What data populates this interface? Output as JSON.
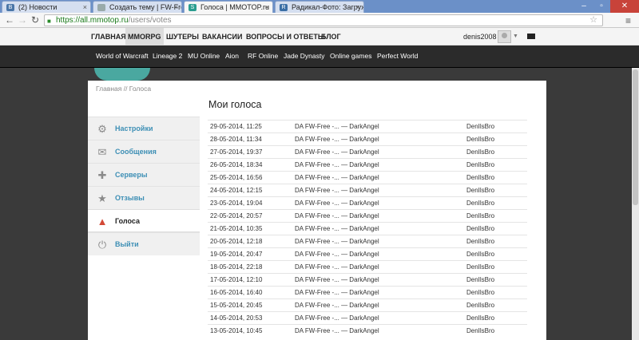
{
  "browser": {
    "tabs": [
      {
        "title": "(2) Новости",
        "favicon": "vk",
        "color": "#4a76a8"
      },
      {
        "title": "Создать тему | FW-Free |",
        "favicon": "page",
        "color": "#9aa"
      },
      {
        "title": "Голоса | MMOTOP.ru",
        "favicon": "mmotop",
        "color": "#2a9d8f"
      },
      {
        "title": "Радикал-Фото: Загружен",
        "favicon": "radikal",
        "color": "#3a6ea5"
      }
    ],
    "url_scheme": "https://",
    "url_host": "all.mmotop.ru",
    "url_path": "/users/votes"
  },
  "site_nav": {
    "items": [
      "ГЛАВНАЯ",
      "MMORPG",
      "ШУТЕРЫ",
      "ВАКАНСИИ",
      "ВОПРОСЫ И ОТВЕТЫ",
      "БЛОГ"
    ],
    "selected": "MMORPG",
    "username": "denis2008"
  },
  "games_bar": [
    "World of Warcraft",
    "Lineage 2",
    "MU Online",
    "Aion",
    "RF Online",
    "Jade Dynasty",
    "Online games",
    "Perfect World"
  ],
  "breadcrumb": "Главная // Голоса",
  "sidebar": {
    "items": [
      {
        "label": "Настройки",
        "icon": "gear-icon"
      },
      {
        "label": "Сообщения",
        "icon": "envelope-icon"
      },
      {
        "label": "Серверы",
        "icon": "gamepad-icon"
      },
      {
        "label": "Отзывы",
        "icon": "star-icon"
      },
      {
        "label": "Голоса",
        "icon": "thumbs-up-icon",
        "active": true
      },
      {
        "label": "Выйти",
        "icon": "power-icon"
      }
    ]
  },
  "page_title": "Мои голоса",
  "votes": [
    {
      "date": "29-05-2014, 11:25",
      "server": "DA FW-Free -... — DarkAngel",
      "user": "DenIlsBro"
    },
    {
      "date": "28-05-2014, 11:34",
      "server": "DA FW-Free -... — DarkAngel",
      "user": "DenIlsBro"
    },
    {
      "date": "27-05-2014, 19:37",
      "server": "DA FW-Free -... — DarkAngel",
      "user": "DenIlsBro"
    },
    {
      "date": "26-05-2014, 18:34",
      "server": "DA FW-Free -... — DarkAngel",
      "user": "DenIlsBro"
    },
    {
      "date": "25-05-2014, 16:56",
      "server": "DA FW-Free -... — DarkAngel",
      "user": "DenIlsBro"
    },
    {
      "date": "24-05-2014, 12:15",
      "server": "DA FW-Free -... — DarkAngel",
      "user": "DenIlsBro"
    },
    {
      "date": "23-05-2014, 19:04",
      "server": "DA FW-Free -... — DarkAngel",
      "user": "DenIlsBro"
    },
    {
      "date": "22-05-2014, 20:57",
      "server": "DA FW-Free -... — DarkAngel",
      "user": "DenIlsBro"
    },
    {
      "date": "21-05-2014, 10:35",
      "server": "DA FW-Free -... — DarkAngel",
      "user": "DenIlsBro"
    },
    {
      "date": "20-05-2014, 12:18",
      "server": "DA FW-Free -... — DarkAngel",
      "user": "DenIlsBro"
    },
    {
      "date": "19-05-2014, 20:47",
      "server": "DA FW-Free -... — DarkAngel",
      "user": "DenIlsBro"
    },
    {
      "date": "18-05-2014, 22:18",
      "server": "DA FW-Free -... — DarkAngel",
      "user": "DenIlsBro"
    },
    {
      "date": "17-05-2014, 12:10",
      "server": "DA FW-Free -... — DarkAngel",
      "user": "DenIlsBro"
    },
    {
      "date": "16-05-2014, 16:40",
      "server": "DA FW-Free -... — DarkAngel",
      "user": "DenIlsBro"
    },
    {
      "date": "15-05-2014, 20:45",
      "server": "DA FW-Free -... — DarkAngel",
      "user": "DenIlsBro"
    },
    {
      "date": "14-05-2014, 20:53",
      "server": "DA FW-Free -... — DarkAngel",
      "user": "DenIlsBro"
    },
    {
      "date": "13-05-2014, 10:45",
      "server": "DA FW-Free -... — DarkAngel",
      "user": "DenIlsBro"
    }
  ]
}
